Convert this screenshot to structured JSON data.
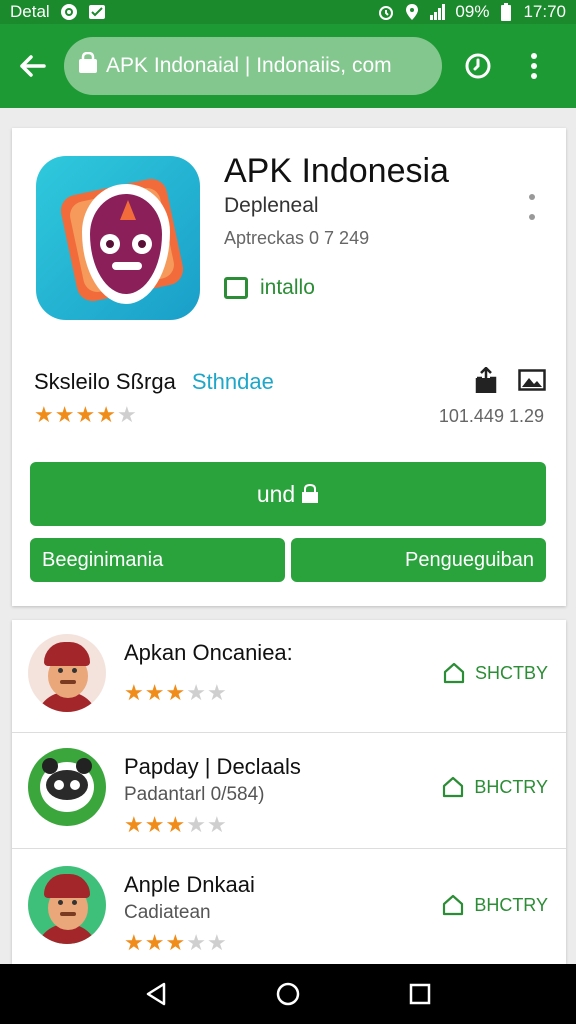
{
  "status_bar": {
    "carrier": "Detal",
    "battery": "09%",
    "time": "17:70"
  },
  "toolbar": {
    "url": "APK Indonaial | Indonaiis, com"
  },
  "app": {
    "title": "APK Indonesia",
    "developer": "Depleneal",
    "version": "Aptreckas 0 7 249",
    "install_label": "intallo",
    "rating_name": "Sksleilo Sßrga",
    "rating_tag": "Sthndae",
    "rating": 4,
    "stats": "101.449 1.29",
    "primary_button": "und",
    "left_button": "Beeginimania",
    "right_button": "Pengueguiban"
  },
  "reviews": [
    {
      "name": "Apkan Oncaniea:",
      "subtitle": "",
      "rating": 3,
      "action": "SHCTBY",
      "avatar": "person-red-hat"
    },
    {
      "name": "Papday | Declaals",
      "subtitle": "Padantarl 0/584)",
      "rating": 3,
      "action": "BHCTRY",
      "avatar": "panda"
    },
    {
      "name": "Anple Dnkaai",
      "subtitle": "Cadiatean",
      "rating": 3,
      "action": "BHCTRY",
      "avatar": "person-red-hat-green"
    }
  ],
  "colors": {
    "status_bar": "#1b8a2c",
    "toolbar": "#1e9a34",
    "accent_green": "#2aa33d",
    "star": "#f08c1a",
    "tag": "#1ea7c9"
  }
}
